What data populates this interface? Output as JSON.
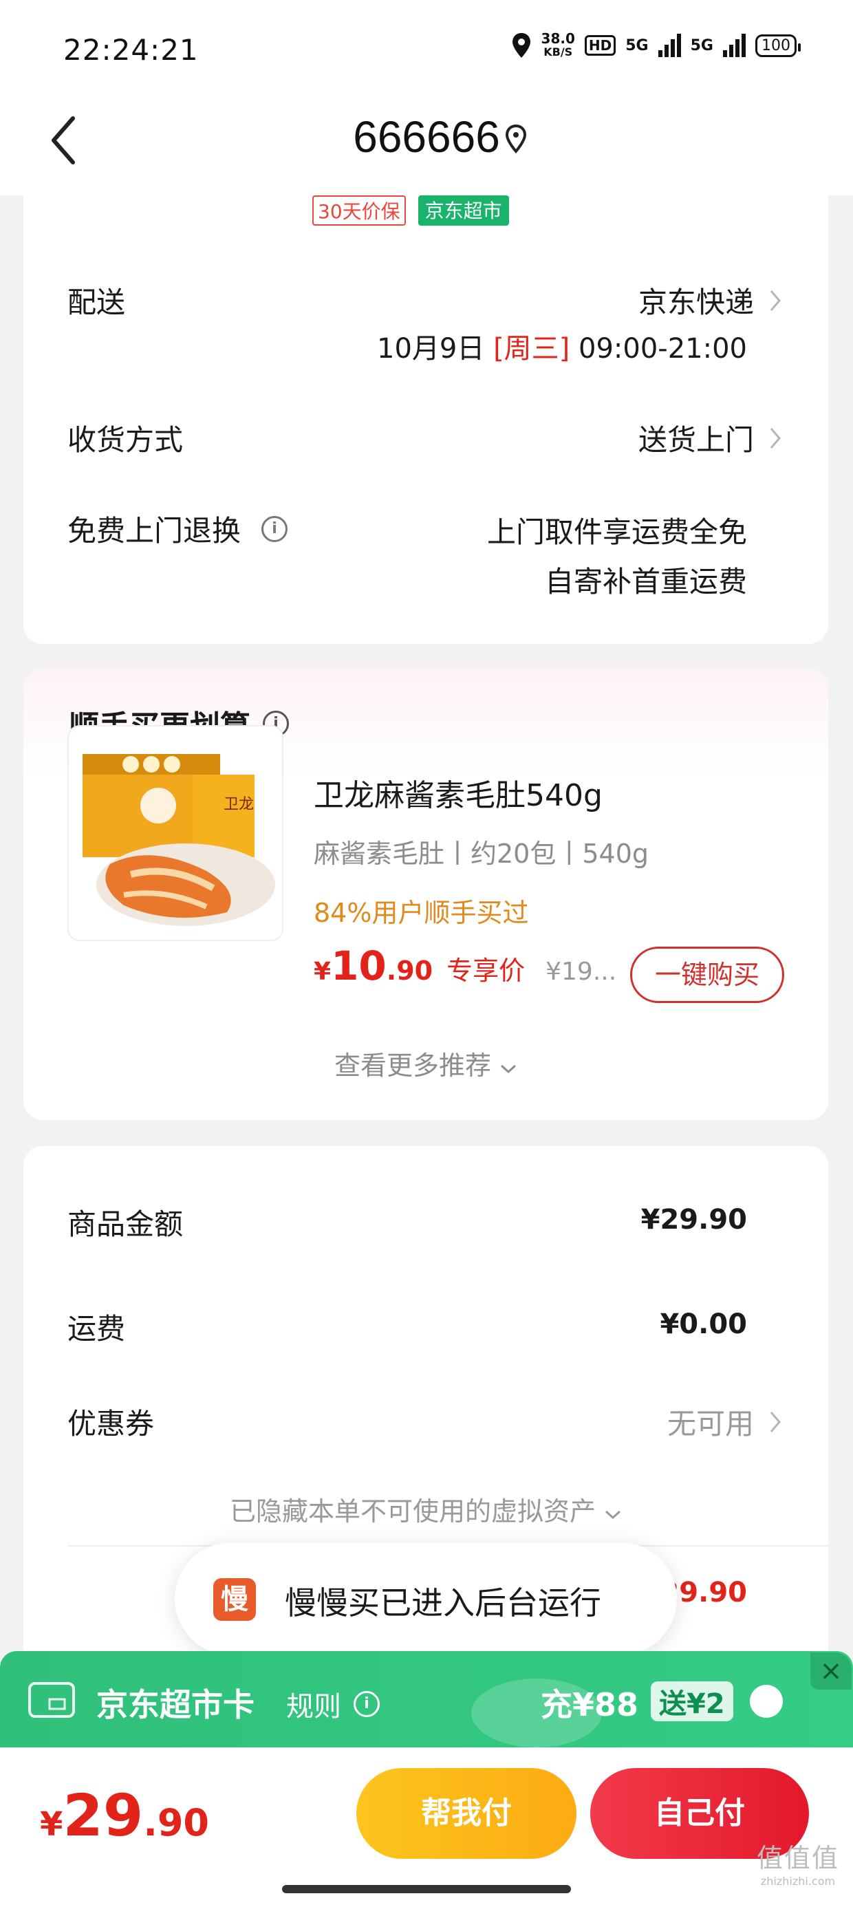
{
  "status_bar": {
    "time": "22:24:21",
    "net_speed_value": "38.0",
    "net_speed_unit": "KB/S",
    "hd_label": "HD",
    "signal1_label": "5G",
    "signal2_label": "5G",
    "battery": "100",
    "icons": [
      "location-icon",
      "hd-icon",
      "signal-5g-icon",
      "signal-5g-icon",
      "battery-icon"
    ]
  },
  "nav": {
    "back_icon": "chevron-left-icon",
    "title": "666666",
    "title_icon": "location-pin-icon"
  },
  "tags": {
    "price_protect": "30天价保",
    "jd_supermarket": "京东超市"
  },
  "delivery": {
    "label": "配送",
    "carrier": "京东快递",
    "date": "10月9日",
    "weekday": "[周三]",
    "time_window": "09:00-21:00"
  },
  "receive": {
    "label": "收货方式",
    "value": "送货上门"
  },
  "returns": {
    "label": "免费上门退换",
    "info_icon": "info-icon",
    "line1": "上门取件享运费全免",
    "line2": "自寄补首重运费"
  },
  "recommend": {
    "title": "顺手买更划算",
    "product_name": "卫龙麻酱素毛肚540g",
    "spec": "麻酱素毛肚丨约20包丨540g",
    "social_proof": "84%用户顺手买过",
    "currency": "¥",
    "price_int": "10",
    "price_dec": ".90",
    "price_tag": "专享价",
    "orig_price": "¥19...",
    "buy_button": "一键购买",
    "more": "查看更多推荐",
    "more_icon": "chevron-down-icon",
    "image_badge": "卫龙"
  },
  "summary": {
    "goods_label": "商品金额",
    "goods_value": "¥29.90",
    "shipping_label": "运费",
    "shipping_value": "¥0.00",
    "coupon_label": "优惠券",
    "coupon_value": "无可用",
    "hidden_assets": "已隐藏本单不可使用的虚拟资产",
    "total_partial": "29.90"
  },
  "toast": {
    "icon_char": "慢",
    "text": "慢慢买已进入后台运行"
  },
  "banner": {
    "title": "京东超市卡",
    "rules": "规则",
    "recharge": "充¥88",
    "bonus": "送¥2",
    "close": "×"
  },
  "bottom": {
    "currency": "¥",
    "total_int": "29",
    "total_dec": ".90",
    "help_pay": "帮我付",
    "self_pay": "自己付",
    "watermark_main": "值值值",
    "watermark_sub": "zhizhizhi.com"
  },
  "colors": {
    "accent_red": "#e2231a",
    "orange": "#e08a1e",
    "green": "#19b36b",
    "yellow_btn": "#fdb913"
  }
}
